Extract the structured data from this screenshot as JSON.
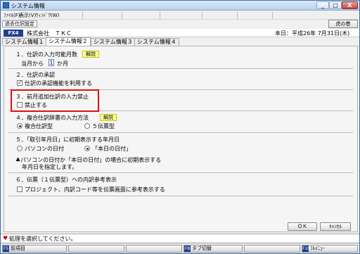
{
  "window": {
    "title": "システム情報",
    "min": "_",
    "max": "□",
    "close": "X"
  },
  "menu": {
    "items": [
      "ﾌｧｲﾙ(F)",
      "表示(V)",
      "ｳｨﾝﾄﾞｳ(W)"
    ]
  },
  "toolbar": {
    "kako_label": "過去仕訳設定",
    "tora_label": "虎の巻"
  },
  "company": {
    "code": "FX4",
    "name": "株式会社　ＴＫＣ",
    "date": "本日：平成26年 7月31日(木)"
  },
  "tabs": [
    "システム情報１",
    "システム情報２",
    "システム情報３",
    "システム情報４"
  ],
  "sections": {
    "s1": {
      "title": "１．仕訳の入力可能月数",
      "help": "解説",
      "prefix": "当月から",
      "value": "1",
      "suffix": "か月"
    },
    "s2": {
      "title": "２．仕訳の承認",
      "option": "仕訳の承認機能を利用する",
      "checked": true
    },
    "s3": {
      "title": "３．前月追加仕訳の入力禁止",
      "option": "禁止する",
      "checked": false
    },
    "s4": {
      "title": "４．複合仕訳辞書の入力方法",
      "help": "解説",
      "opt1": "複合仕訳型",
      "opt2": "５伝票型"
    },
    "s5": {
      "title": "５．「取引年月日」に初期表示する年月日",
      "opt1": "パソコンの日付",
      "opt2": "「本日の日付」",
      "note1": "♣パソコンの日付か「本日の日付」の場合に初期表示する",
      "note2": "年月日を指定します。"
    },
    "s6": {
      "title": "６．伝票（１伝票型）への内訳参考表示",
      "option": "プロジェクト、内訳コード等を伝票画面に参考表示する",
      "checked": false
    }
  },
  "buttons": {
    "ok": "ＯＫ",
    "cancel": "ｷｬﾝｾﾙ"
  },
  "status": {
    "text": "処理を選択してください。"
  },
  "fkeys": [
    {
      "num": "F5",
      "label": "前項目"
    },
    {
      "num": "F8",
      "label": "タブ切替"
    },
    {
      "num": "F10",
      "label": "ﾌﾙﾒﾆｭｰ"
    }
  ],
  "colors": {
    "accent": "#1f3f8f",
    "highlight": "#e01010",
    "help": "#ffff99"
  }
}
